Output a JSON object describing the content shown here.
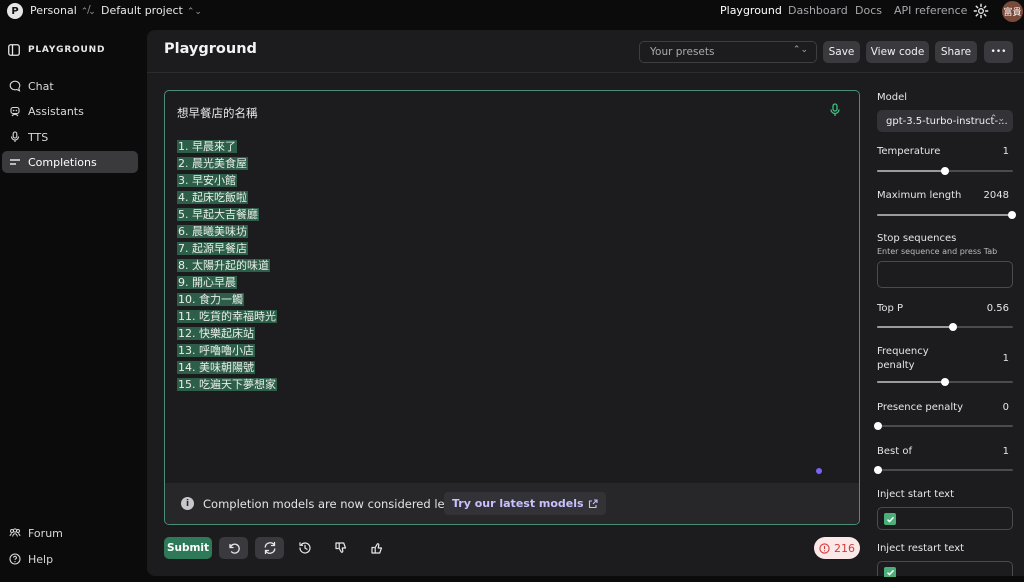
{
  "topbar": {
    "org_initial": "P",
    "org_name": "Personal",
    "project_name": "Default project",
    "links": [
      "Playground",
      "Dashboard",
      "Docs",
      "API reference"
    ],
    "user_avatar": "富貴"
  },
  "sidebar": {
    "title": "PLAYGROUND",
    "items": [
      {
        "label": "Chat",
        "icon": "chat-bubble-icon"
      },
      {
        "label": "Assistants",
        "icon": "assistant-icon"
      },
      {
        "label": "TTS",
        "icon": "microphone-icon"
      },
      {
        "label": "Completions",
        "icon": "completions-icon",
        "active": true
      }
    ],
    "bottom": [
      {
        "label": "Forum",
        "icon": "people-icon"
      },
      {
        "label": "Help",
        "icon": "help-icon"
      }
    ]
  },
  "header": {
    "title": "Playground",
    "presets_placeholder": "Your presets",
    "save_label": "Save",
    "view_code_label": "View code",
    "share_label": "Share",
    "more_label": "•••"
  },
  "editor": {
    "prompt": "想早餐店的名稱",
    "completions": [
      "1. 早晨來了",
      "2. 晨光美食屋",
      "3. 早安小館",
      "4. 起床吃飯啦",
      "5. 早起大吉餐廳",
      "6. 晨曦美味坊",
      "7. 起源早餐店",
      "8. 太陽升起的味道",
      "9. 開心早晨",
      "10. 食力一觸",
      "11. 吃貨的幸福時光",
      "12. 快樂起床站",
      "13. 呼嚕嚕小店",
      "14. 美味朝陽號",
      "15. 吃遍天下夢想家"
    ],
    "legacy_message": "Completion models are now considered legacy.",
    "legacy_link": "Try our latest models"
  },
  "footer": {
    "submit_label": "Submit",
    "token_count": "216"
  },
  "settings": {
    "model_label": "Model",
    "model_value": "gpt-3.5-turbo-instruct-...",
    "temperature": {
      "label": "Temperature",
      "value": "1",
      "fraction": 0.5
    },
    "max_length": {
      "label": "Maximum length",
      "value": "2048",
      "fraction": 1.0
    },
    "stop_sequences": {
      "label": "Stop sequences",
      "hint": "Enter sequence and press Tab"
    },
    "top_p": {
      "label": "Top P",
      "value": "0.56",
      "fraction": 0.56
    },
    "frequency_penalty": {
      "label_line1": "Frequency",
      "label_line2": "penalty",
      "value": "1",
      "fraction": 0.5
    },
    "presence_penalty": {
      "label": "Presence penalty",
      "value": "0",
      "fraction": 0.0
    },
    "best_of": {
      "label": "Best of",
      "value": "1",
      "fraction": 0.0
    },
    "inject_start": {
      "label": "Inject start text",
      "checked": true
    },
    "inject_restart": {
      "label": "Inject restart text",
      "checked": true
    }
  },
  "colors": {
    "accent_green": "#2e7a58",
    "highlight": "#2d5e49",
    "editor_border": "#4a8f74",
    "link_purple": "#c9c1ff",
    "token_badge_bg": "#fde8e8",
    "token_badge_text": "#d23b3b"
  }
}
